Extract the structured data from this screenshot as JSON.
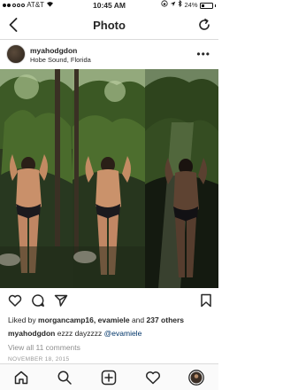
{
  "status_bar": {
    "carrier": "AT&T",
    "time": "10:45 AM",
    "battery": "24%"
  },
  "nav": {
    "title": "Photo"
  },
  "post": {
    "username": "myahodgdon",
    "location": "Hobe Sound, Florida",
    "likes_prefix": "Liked by",
    "liker_1": "morgancamp16",
    "liker_2": "evamiele",
    "likes_and": "and",
    "likes_others": "237 others",
    "caption_user": "myahodgdon",
    "caption_text": "ezzz dayzzzz",
    "caption_tag": "@evamiele",
    "comments_link": "View all 11 comments",
    "date": "NOVEMBER 18, 2015"
  },
  "icons": {
    "back": "chevron-left-icon",
    "refresh": "refresh-icon",
    "more": "more-icon",
    "like": "heart-icon",
    "comment": "comment-icon",
    "share": "send-icon",
    "save": "bookmark-icon",
    "tabs": [
      "home-icon",
      "search-icon",
      "add-icon",
      "heart-icon",
      "profile-icon"
    ]
  }
}
